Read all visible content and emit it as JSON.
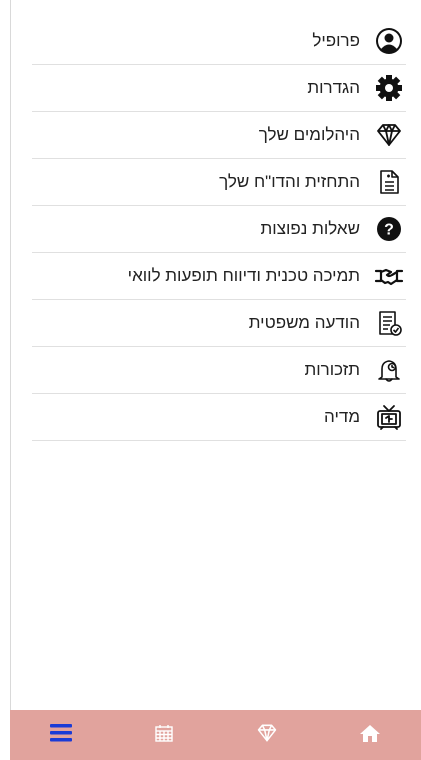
{
  "menu": {
    "items": [
      {
        "label": "פרופיל",
        "icon": "user-circle-icon"
      },
      {
        "label": "הגדרות",
        "icon": "gear-icon"
      },
      {
        "label": "היהלומים שלך",
        "icon": "diamond-icon"
      },
      {
        "label": "התחזית והדו\"ח שלך",
        "icon": "document-icon"
      },
      {
        "label": "שאלות נפוצות",
        "icon": "question-circle-icon"
      },
      {
        "label": "תמיכה טכנית ודיווח תופעות לוואי",
        "icon": "handshake-icon"
      },
      {
        "label": "הודעה משפטית",
        "icon": "legal-document-icon"
      },
      {
        "label": "תזכורות",
        "icon": "bell-icon"
      },
      {
        "label": "מדיה",
        "icon": "tv-icon"
      }
    ]
  },
  "bottom_nav": {
    "items": [
      {
        "icon": "menu-icon",
        "active": true
      },
      {
        "icon": "calendar-icon",
        "active": false
      },
      {
        "icon": "diamond-icon",
        "active": false
      },
      {
        "icon": "home-icon",
        "active": false
      }
    ],
    "background": "#e1a39d",
    "active_color": "#1a3bd6",
    "inactive_color": "#ffffff"
  }
}
